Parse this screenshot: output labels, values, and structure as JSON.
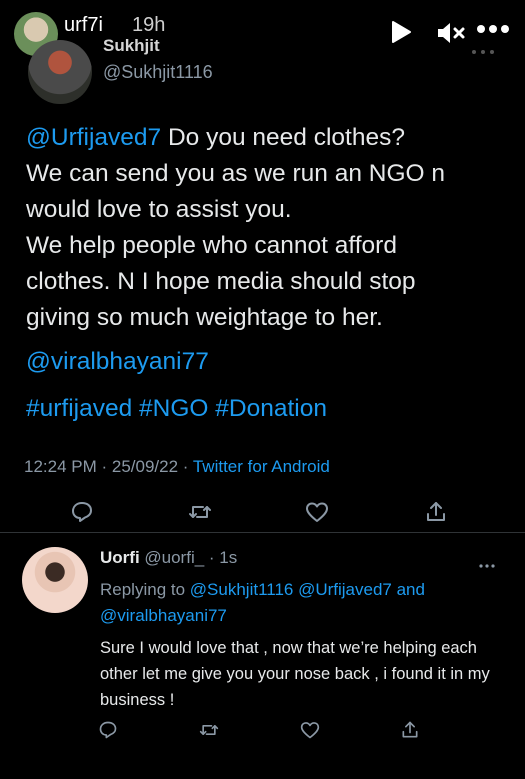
{
  "story": {
    "username": "urf7i",
    "time": "19h"
  },
  "tweet": {
    "name": "Sukhjit",
    "handle": "@Sukhjit1116",
    "mention": "@Urfijaved7",
    "lines": [
      " Do you need clothes?",
      "We can send you as we run an NGO n",
      "would love to assist you.",
      "We help people who cannot afford",
      "clothes. N I hope media should stop",
      "giving so much weightage to her."
    ],
    "mention2": "@viralbhayani77",
    "hashtags": "#urfijaved #NGO #Donation",
    "time": "12:24 PM · 25/09/22 · ",
    "source": "Twitter for Android"
  },
  "reply": {
    "name": "Uorfi",
    "handle": " @uorfi_ · 1s",
    "replying_prefix": "Replying to ",
    "replying_mentions": "@Sukhjit1116 @Urfijaved7 and @viralbhayani77",
    "body": "Sure I would love that , now that we’re helping each other let me give you your nose back , i found it in my business !"
  },
  "icons": {
    "colors": {
      "link": "#1d9bf0",
      "muted": "#8b98a5",
      "text": "#e7e9ea"
    }
  }
}
